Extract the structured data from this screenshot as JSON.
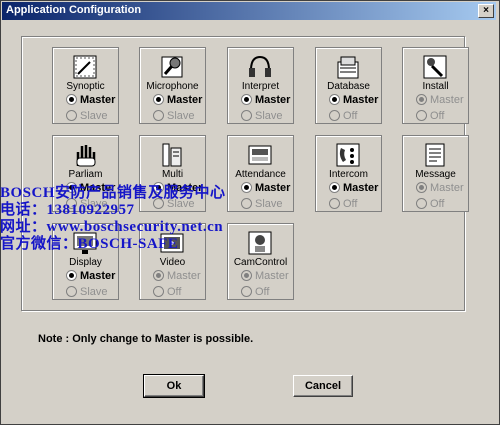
{
  "window": {
    "title": "Application Configuration",
    "close_glyph": "×"
  },
  "tiles": [
    {
      "name": "Synoptic",
      "icon": "synoptic-icon",
      "opt1": "Master",
      "opt2": "Slave",
      "opt1_on": true,
      "disabled": false
    },
    {
      "name": "Microphone",
      "icon": "microphone-icon",
      "opt1": "Master",
      "opt2": "Slave",
      "opt1_on": true,
      "disabled": false
    },
    {
      "name": "Interpret",
      "icon": "headphones-icon",
      "opt1": "Master",
      "opt2": "Slave",
      "opt1_on": true,
      "disabled": false
    },
    {
      "name": "Database",
      "icon": "database-icon",
      "opt1": "Master",
      "opt2": "Off",
      "opt1_on": true,
      "disabled": false
    },
    {
      "name": "Install",
      "icon": "install-icon",
      "opt1": "Master",
      "opt2": "Off",
      "opt1_on": true,
      "disabled": true
    },
    {
      "name": "Parliam",
      "icon": "hand-icon",
      "opt1": "Master",
      "opt2": "Slave",
      "opt1_on": true,
      "disabled": false
    },
    {
      "name": "Multi",
      "icon": "multi-icon",
      "opt1": "Master",
      "opt2": "Slave",
      "opt1_on": true,
      "disabled": false
    },
    {
      "name": "Attendance",
      "icon": "attendance-icon",
      "opt1": "Master",
      "opt2": "Slave",
      "opt1_on": true,
      "disabled": false
    },
    {
      "name": "Intercom",
      "icon": "intercom-icon",
      "opt1": "Master",
      "opt2": "Off",
      "opt1_on": true,
      "disabled": false
    },
    {
      "name": "Message",
      "icon": "message-icon",
      "opt1": "Master",
      "opt2": "Off",
      "opt1_on": true,
      "disabled": true
    },
    {
      "name": "Display",
      "icon": "display-icon",
      "opt1": "Master",
      "opt2": "Slave",
      "opt1_on": true,
      "disabled": false
    },
    {
      "name": "Video",
      "icon": "video-icon",
      "opt1": "Master",
      "opt2": "Off",
      "opt1_on": true,
      "disabled": true
    },
    {
      "name": "CamControl",
      "icon": "camera-control-icon",
      "opt1": "Master",
      "opt2": "Off",
      "opt1_on": true,
      "disabled": true
    }
  ],
  "note": "Note : Only change to Master is possible.",
  "buttons": {
    "ok": "Ok",
    "cancel": "Cancel"
  },
  "overlay": {
    "line1": "BOSCH安防产品销售及服务中心",
    "line2": "电话：13810922957",
    "line3": "网址：www.boschsecurity.net.cn",
    "line4": "官方微信：BOSCH-SAFE"
  }
}
